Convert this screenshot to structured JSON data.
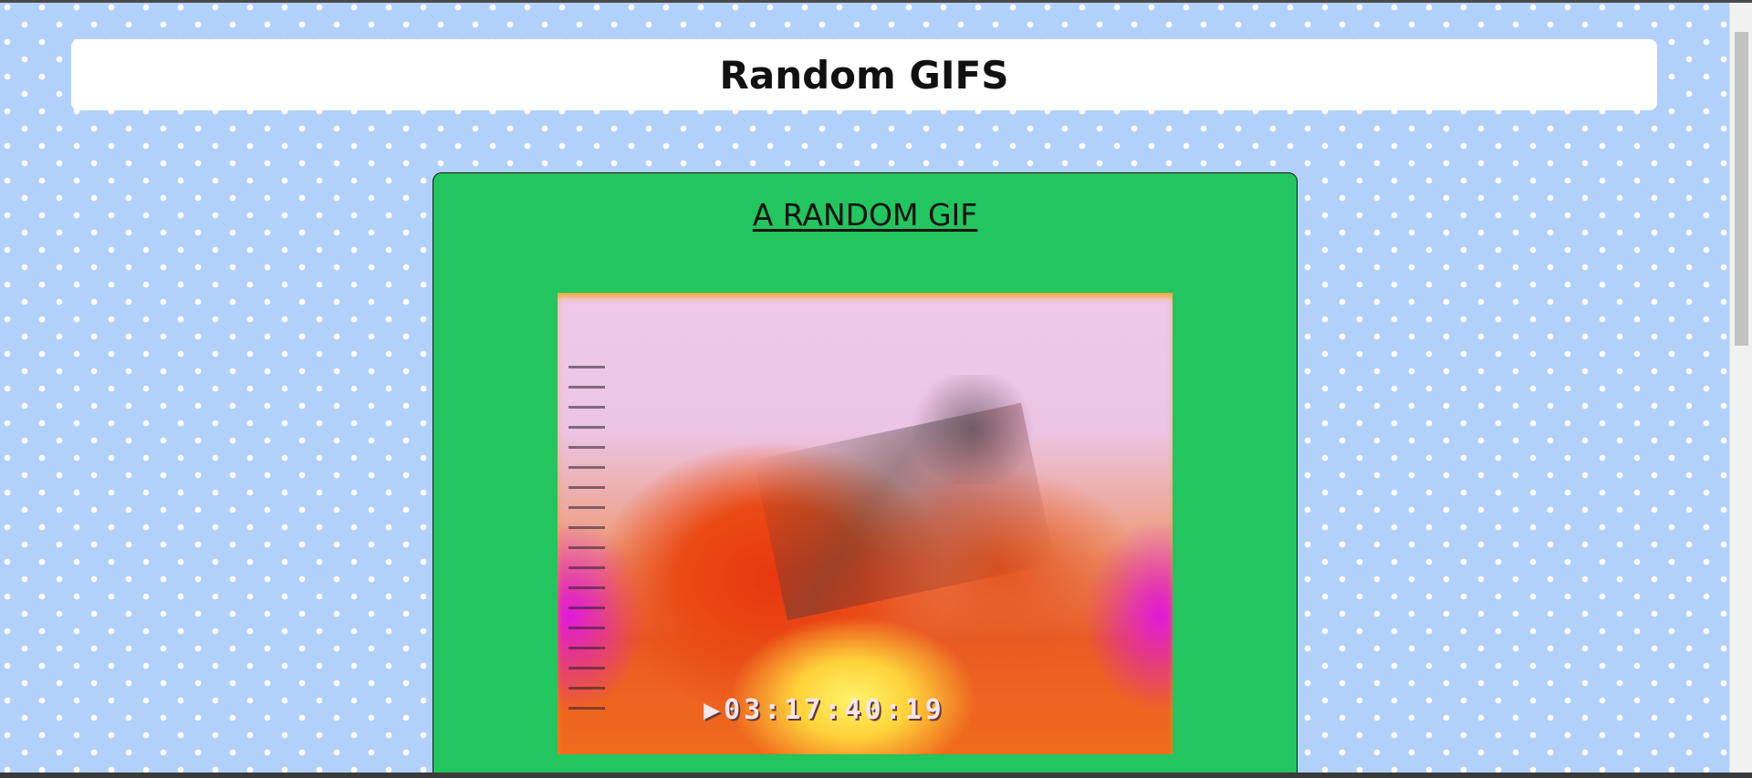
{
  "page": {
    "title": "Random GIFS"
  },
  "card": {
    "title": "A RANDOM GIF",
    "gif": {
      "timestamp": "▶03:17:40:19"
    }
  },
  "colors": {
    "background": "#b1d1fb",
    "dots": "#ffffff",
    "header_bg": "#ffffff",
    "card_bg": "#22c55e",
    "text": "#111111"
  }
}
